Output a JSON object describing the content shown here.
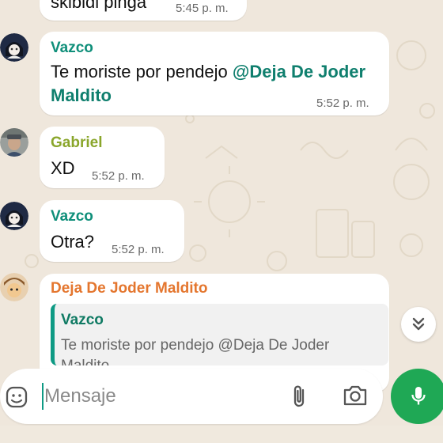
{
  "messages": [
    {
      "text": "skibidi pinga",
      "time": "5:45 p. m."
    },
    {
      "sender": "Vazco",
      "sender_color": "#0f8f7a",
      "text_before": "Te moriste por pendejo ",
      "mention": "@Deja De Joder Maldito",
      "time": "5:52 p. m."
    },
    {
      "sender": "Gabriel",
      "sender_color": "#8aa62b",
      "text": "XD",
      "time": "5:52 p. m."
    },
    {
      "sender": "Vazco",
      "sender_color": "#0f8f7a",
      "text": "Otra?",
      "time": "5:52 p. m."
    },
    {
      "sender": "Deja De Joder Maldito",
      "sender_color": "#e4762e",
      "quote": {
        "sender": "Vazco",
        "text": "Te moriste por pendejo @Deja De Joder Maldito"
      }
    }
  ],
  "composer": {
    "placeholder": "Mensaje"
  },
  "icons": {
    "sticker": "sticker-icon",
    "attach": "paperclip-icon",
    "camera": "camera-icon",
    "mic": "microphone-icon",
    "scroll": "double-chevron-down-icon"
  },
  "colors": {
    "accent": "#1fa855",
    "wallpaper": "#efe7dc",
    "bubble": "#ffffff"
  }
}
